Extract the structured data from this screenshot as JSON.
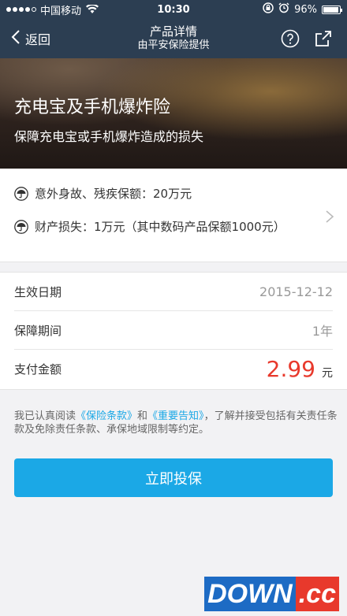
{
  "status_bar": {
    "carrier": "中国移动",
    "time": "10:30",
    "battery": "96%",
    "battery_level": 0.96,
    "signal_filled": 4,
    "signal_total": 5
  },
  "nav": {
    "back_label": "返回",
    "title": "产品详情",
    "subtitle": "由平安保险提供",
    "help_icon": "question-circle-icon",
    "share_icon": "share-icon"
  },
  "banner": {
    "title": "充电宝及手机爆炸险",
    "subtitle": "保障充电宝或手机爆炸造成的损失"
  },
  "coverage": {
    "items": [
      {
        "icon": "umbrella-icon",
        "text": "意外身故、残疾保额：20万元"
      },
      {
        "icon": "umbrella-icon",
        "text": "财产损失：1万元（其中数码产品保额1000元）"
      }
    ]
  },
  "details": {
    "effective_date_label": "生效日期",
    "effective_date_value": "2015-12-12",
    "period_label": "保障期间",
    "period_value": "1年",
    "amount_label": "支付金额",
    "amount_value": "2.99",
    "amount_unit": "元"
  },
  "agreement": {
    "prefix": "我已认真阅读",
    "link1": "《保险条款》",
    "and": "和",
    "link2": "《重要告知》",
    "suffix": "，了解并接受包括有关责任条款及免除责任条款、承保地域限制等约定。"
  },
  "submit_label": "立即投保",
  "watermark": {
    "text1": "DOWN",
    "text2": ".cc"
  },
  "colors": {
    "nav_bg": "#2c3e52",
    "accent": "#1ba8e6",
    "price": "#e8392c"
  }
}
